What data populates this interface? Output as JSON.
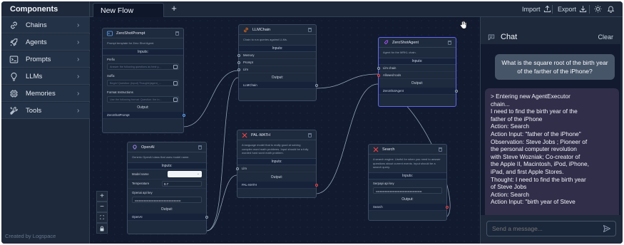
{
  "sidebar": {
    "title": "Components",
    "items": [
      {
        "label": "Chains",
        "icon": "link-icon"
      },
      {
        "label": "Agents",
        "icon": "rocket-icon"
      },
      {
        "label": "Prompts",
        "icon": "terminal-icon"
      },
      {
        "label": "LLMs",
        "icon": "lightbulb-icon"
      },
      {
        "label": "Memories",
        "icon": "cpu-icon"
      },
      {
        "label": "Tools",
        "icon": "wrench-icon"
      }
    ],
    "footer": "Created by Logspace"
  },
  "topbar": {
    "tab_label": "New Flow",
    "import_label": "Import",
    "export_label": "Export"
  },
  "nodes": {
    "zeroshotprompt": {
      "title": "ZeroShotPrompt",
      "description": "Prompt template for Zero Shot Agent.",
      "inputs_label": "Inputs:",
      "prefix_label": "Prefix",
      "prefix_value": "Answer the following questions as best y...",
      "suffix_label": "Suffix",
      "suffix_value": "Begin! Question: {input} Thought:{agent_...",
      "format_label": "Format Instructions",
      "format_value": "Use the following format: Question: the in...",
      "output_label": "Output:",
      "output_name": "ZeroShotPrompt"
    },
    "llmchain": {
      "title": "LLMChain",
      "description": "Chain to run queries against LLMs.",
      "inputs_label": "Inputs:",
      "input_memory": "Memory",
      "input_prompt": "Prompt",
      "input_llm": "Llm",
      "output_label": "Output:",
      "output_name": "LLMChain"
    },
    "zeroshotagent": {
      "title": "ZeroShotAgent",
      "description": "Agent for the MRKL chain.",
      "inputs_label": "Inputs:",
      "input_llm_chain": "Llm chain",
      "input_allowed_tools": "Allowed tools",
      "output_label": "Output:",
      "output_name": "ZeroShotAgent"
    },
    "openai": {
      "title": "OpenAI",
      "description": "Generic OpenAI class that uses model name.",
      "inputs_label": "Inputs:",
      "model_label": "Model name",
      "temperature_label": "Temperature",
      "temperature_value": "0.7",
      "apikey_label": "Openai api key",
      "apikey_value": "••••••••••••••••••••••••••••••••••••••••••••••",
      "output_label": "Output:",
      "output_name": "OpenAI"
    },
    "palmath": {
      "title": "PAL-MATH",
      "description": "A language model that is really good at solving complex word math problems. Input should be a fully worded hard word math problem.",
      "inputs_label": "Inputs:",
      "input_llm": "Llm",
      "output_label": "Output:",
      "output_name": "PAL-MATH"
    },
    "search": {
      "title": "Search",
      "description": "A search engine. Useful for when you need to answer questions about current events. Input should be a search query.",
      "inputs_label": "Inputs:",
      "apikey_label": "Serpapi api key",
      "apikey_value": "••••••••••••••••••••••••••••••••••••••••••••••",
      "output_label": "Output:",
      "output_name": "Search"
    }
  },
  "chat": {
    "title": "Chat",
    "clear_label": "Clear",
    "user_message": "What is the square root of the birth year of the farther of the iPhone?",
    "bot_lines": [
      "> Entering new AgentExecutor",
      "chain...",
      "I need to find the birth year of the",
      "father of the iPhone",
      "Action: Search",
      "Action Input: \"father of the iPhone\"",
      "Observation: Steve Jobs ; Pioneer of",
      "the personal computer revolution",
      "with Steve Wozniak; Co-creator of",
      "the Apple II, Macintosh, iPod, iPhone,",
      "iPad, and first Apple Stores.",
      "Thought: I need to find the birth year",
      "of Steve Jobs",
      "Action: Search",
      "Action Input: \"birth year of Steve"
    ],
    "input_placeholder": "Send a message..."
  },
  "colors": {
    "background": "#0f172a",
    "panel": "#1e293b",
    "accent": "#6366f1",
    "edge": "#94a3b8",
    "output_handle": "#ef4444"
  }
}
